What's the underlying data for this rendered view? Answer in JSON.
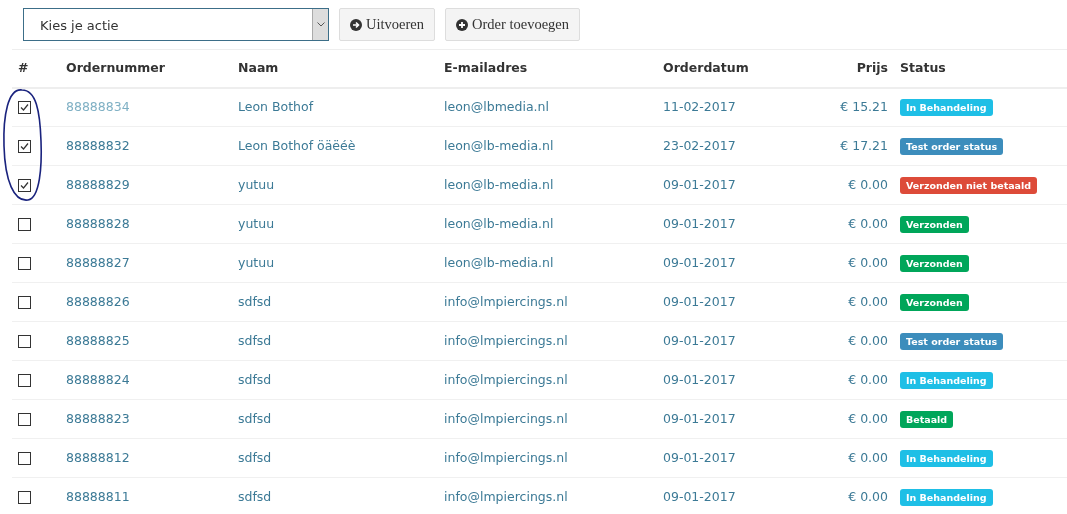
{
  "toolbar": {
    "action_select": {
      "value": "Kies je actie"
    },
    "buttons": [
      {
        "label": "Uitvoeren",
        "kind": "arrow"
      },
      {
        "label": "Order toevoegen",
        "kind": "plus"
      }
    ]
  },
  "table": {
    "columns": [
      "#",
      "Ordernummer",
      "Naam",
      "E-mailadres",
      "Orderdatum",
      "Prijs",
      "Status"
    ],
    "rows": [
      {
        "checked": true,
        "dimmed": true,
        "order": "88888834",
        "name": "Leon Bothof",
        "email": "leon@lbmedia.nl",
        "date": "11-02-2017",
        "price": "€ 15.21",
        "status": "In Behandeling",
        "color": "#1ebfe6"
      },
      {
        "checked": true,
        "dimmed": false,
        "order": "88888832",
        "name": "Leon Bothof öäëéè",
        "email": "leon@lb-media.nl",
        "date": "23-02-2017",
        "price": "€ 17.21",
        "status": "Test order status",
        "color": "#3c8dbc"
      },
      {
        "checked": true,
        "dimmed": false,
        "order": "88888829",
        "name": "yutuu",
        "email": "leon@lb-media.nl",
        "date": "09-01-2017",
        "price": "€ 0.00",
        "status": "Verzonden niet betaald",
        "color": "#dd4b39"
      },
      {
        "checked": false,
        "dimmed": false,
        "order": "88888828",
        "name": "yutuu",
        "email": "leon@lb-media.nl",
        "date": "09-01-2017",
        "price": "€ 0.00",
        "status": "Verzonden",
        "color": "#00a65a"
      },
      {
        "checked": false,
        "dimmed": false,
        "order": "88888827",
        "name": "yutuu",
        "email": "leon@lb-media.nl",
        "date": "09-01-2017",
        "price": "€ 0.00",
        "status": "Verzonden",
        "color": "#00a65a"
      },
      {
        "checked": false,
        "dimmed": false,
        "order": "88888826",
        "name": "sdfsd",
        "email": "info@lmpiercings.nl",
        "date": "09-01-2017",
        "price": "€ 0.00",
        "status": "Verzonden",
        "color": "#00a65a"
      },
      {
        "checked": false,
        "dimmed": false,
        "order": "88888825",
        "name": "sdfsd",
        "email": "info@lmpiercings.nl",
        "date": "09-01-2017",
        "price": "€ 0.00",
        "status": "Test order status",
        "color": "#3c8dbc"
      },
      {
        "checked": false,
        "dimmed": false,
        "order": "88888824",
        "name": "sdfsd",
        "email": "info@lmpiercings.nl",
        "date": "09-01-2017",
        "price": "€ 0.00",
        "status": "In Behandeling",
        "color": "#1ebfe6"
      },
      {
        "checked": false,
        "dimmed": false,
        "order": "88888823",
        "name": "sdfsd",
        "email": "info@lmpiercings.nl",
        "date": "09-01-2017",
        "price": "€ 0.00",
        "status": "Betaald",
        "color": "#00a65a"
      },
      {
        "checked": false,
        "dimmed": false,
        "order": "88888812",
        "name": "sdfsd",
        "email": "info@lmpiercings.nl",
        "date": "09-01-2017",
        "price": "€ 0.00",
        "status": "In Behandeling",
        "color": "#1ebfe6"
      },
      {
        "checked": false,
        "dimmed": false,
        "order": "88888811",
        "name": "sdfsd",
        "email": "info@lmpiercings.nl",
        "date": "09-01-2017",
        "price": "€ 0.00",
        "status": "In Behandeling",
        "color": "#1ebfe6"
      }
    ]
  },
  "annotation": {
    "kind": "circle"
  }
}
